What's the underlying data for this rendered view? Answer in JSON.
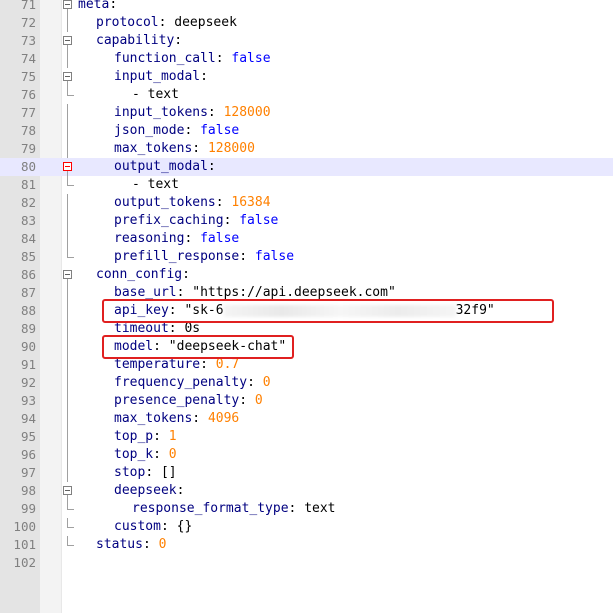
{
  "editor": {
    "current_line": 80,
    "lines": [
      {
        "n": "71",
        "indent": 0,
        "key": "meta",
        "val": "",
        "type": "plain",
        "fold": "open"
      },
      {
        "n": "72",
        "indent": 2,
        "key": "protocol",
        "val": "deepseek",
        "type": "plain",
        "fold": "line"
      },
      {
        "n": "73",
        "indent": 2,
        "key": "capability",
        "val": "",
        "type": "plain",
        "fold": "open"
      },
      {
        "n": "74",
        "indent": 4,
        "key": "function_call",
        "val": "false",
        "type": "bool",
        "fold": "line"
      },
      {
        "n": "75",
        "indent": 4,
        "key": "input_modal",
        "val": "",
        "type": "plain",
        "fold": "open"
      },
      {
        "n": "76",
        "indent": 6,
        "key": "",
        "val": "- text",
        "type": "plain",
        "fold": "end"
      },
      {
        "n": "77",
        "indent": 4,
        "key": "input_tokens",
        "val": "128000",
        "type": "num",
        "fold": "line"
      },
      {
        "n": "78",
        "indent": 4,
        "key": "json_mode",
        "val": "false",
        "type": "bool",
        "fold": "line"
      },
      {
        "n": "79",
        "indent": 4,
        "key": "max_tokens",
        "val": "128000",
        "type": "num",
        "fold": "line"
      },
      {
        "n": "80",
        "indent": 4,
        "key": "output_modal",
        "val": "",
        "type": "plain",
        "fold": "open-active"
      },
      {
        "n": "81",
        "indent": 6,
        "key": "",
        "val": "- text",
        "type": "plain",
        "fold": "end"
      },
      {
        "n": "82",
        "indent": 4,
        "key": "output_tokens",
        "val": "16384",
        "type": "num",
        "fold": "line"
      },
      {
        "n": "83",
        "indent": 4,
        "key": "prefix_caching",
        "val": "false",
        "type": "bool",
        "fold": "line"
      },
      {
        "n": "84",
        "indent": 4,
        "key": "reasoning",
        "val": "false",
        "type": "bool",
        "fold": "line"
      },
      {
        "n": "85",
        "indent": 4,
        "key": "prefill_response",
        "val": "false",
        "type": "bool",
        "fold": "end"
      },
      {
        "n": "86",
        "indent": 2,
        "key": "conn_config",
        "val": "",
        "type": "plain",
        "fold": "open"
      },
      {
        "n": "87",
        "indent": 4,
        "key": "base_url",
        "val": "\"https://api.deepseek.com\"",
        "type": "plain",
        "fold": "line"
      },
      {
        "n": "88",
        "indent": 4,
        "key": "api_key",
        "val": "\"sk-6",
        "val_tail": "32f9\"",
        "type": "redacted",
        "fold": "line"
      },
      {
        "n": "89",
        "indent": 4,
        "key": "timeout",
        "val": "0s",
        "type": "plain",
        "fold": "line"
      },
      {
        "n": "90",
        "indent": 4,
        "key": "model",
        "val": "\"deepseek-chat\"",
        "type": "plain",
        "fold": "line"
      },
      {
        "n": "91",
        "indent": 4,
        "key": "temperature",
        "val": "0.7",
        "type": "num",
        "fold": "line"
      },
      {
        "n": "92",
        "indent": 4,
        "key": "frequency_penalty",
        "val": "0",
        "type": "num",
        "fold": "line"
      },
      {
        "n": "93",
        "indent": 4,
        "key": "presence_penalty",
        "val": "0",
        "type": "num",
        "fold": "line"
      },
      {
        "n": "94",
        "indent": 4,
        "key": "max_tokens",
        "val": "4096",
        "type": "num",
        "fold": "line"
      },
      {
        "n": "95",
        "indent": 4,
        "key": "top_p",
        "val": "1",
        "type": "num",
        "fold": "line"
      },
      {
        "n": "96",
        "indent": 4,
        "key": "top_k",
        "val": "0",
        "type": "num",
        "fold": "line"
      },
      {
        "n": "97",
        "indent": 4,
        "key": "stop",
        "val": "[]",
        "type": "plain",
        "fold": "line"
      },
      {
        "n": "98",
        "indent": 4,
        "key": "deepseek",
        "val": "",
        "type": "plain",
        "fold": "open"
      },
      {
        "n": "99",
        "indent": 6,
        "key": "response_format_type",
        "val": "text",
        "type": "plain",
        "fold": "end"
      },
      {
        "n": "100",
        "indent": 4,
        "key": "custom",
        "val": "{}",
        "type": "plain",
        "fold": "end"
      },
      {
        "n": "101",
        "indent": 2,
        "key": "status",
        "val": "0",
        "type": "num",
        "fold": "end"
      },
      {
        "n": "102",
        "indent": 0,
        "key": "",
        "val": "",
        "type": "plain",
        "fold": "none"
      }
    ],
    "highlights": [
      {
        "line": "88",
        "label": "api-key-highlight"
      },
      {
        "line": "90",
        "label": "model-highlight"
      }
    ],
    "colors": {
      "key": "#000080",
      "bool": "#0000ff",
      "number": "#ff8000",
      "highlight_box": "#e02020",
      "current_line": "#e8e8ff"
    }
  }
}
